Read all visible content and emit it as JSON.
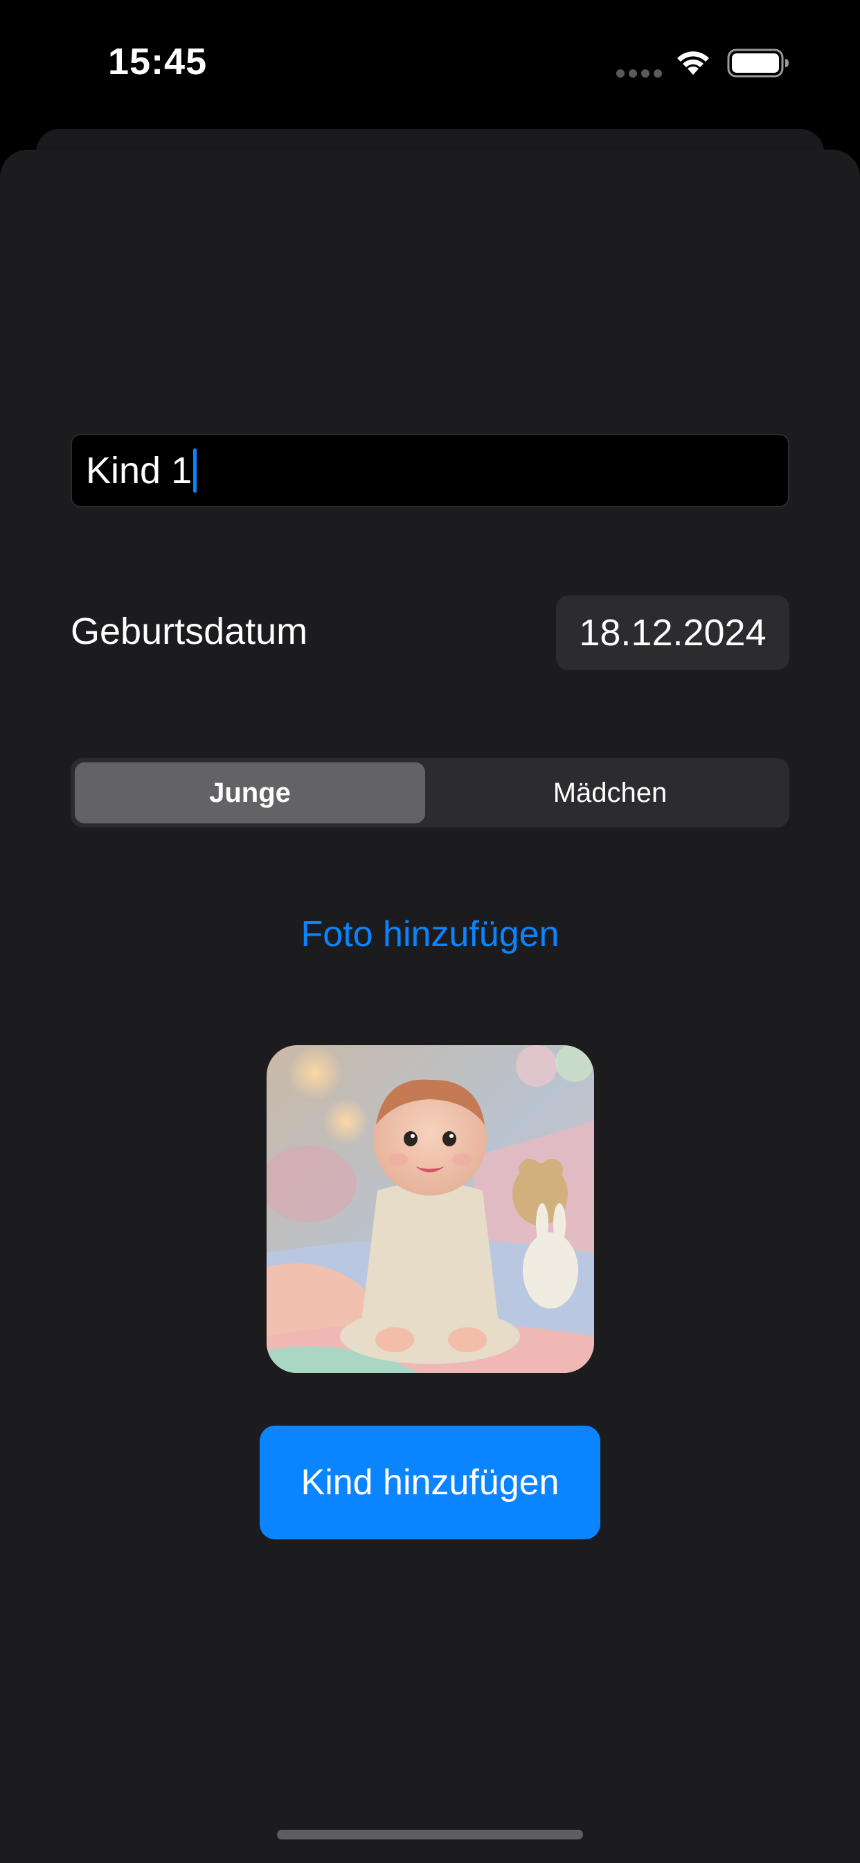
{
  "status_bar": {
    "time": "15:45",
    "icons": [
      "signal-dots-icon",
      "wifi-icon",
      "battery-icon"
    ]
  },
  "form": {
    "name_field": {
      "value": "Kind 1"
    },
    "birthdate": {
      "label": "Geburtsdatum",
      "value": "18.12.2024"
    },
    "gender": {
      "options": [
        "Junge",
        "Mädchen"
      ],
      "selected": "Junge"
    },
    "add_photo_label": "Foto hinzufügen",
    "photo": {
      "icon": "baby-photo"
    },
    "submit_label": "Kind hinzufügen"
  },
  "colors": {
    "accent": "#0a84ff",
    "background": "#1c1c1e",
    "field_background": "#000000",
    "control_background": "#2c2c2e",
    "segment_selected": "#636366"
  }
}
